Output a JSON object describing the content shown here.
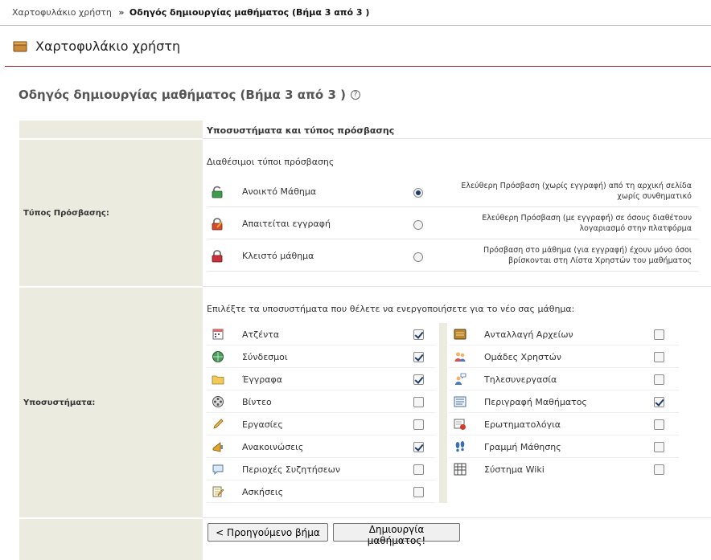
{
  "breadcrumb": {
    "home": "Χαρτοφυλάκιο χρήστη",
    "separator": "»",
    "current": "Οδηγός δημιουργίας μαθήματος (Βήμα 3 από 3 )"
  },
  "page_title": "Χαρτοφυλάκιο χρήστη",
  "wizard_title": "Οδηγός δημιουργίας μαθήματος (Βήμα 3 από 3 )",
  "help_symbol": "?",
  "section_header": "Υποσυστήματα και τύπος πρόσβασης",
  "access": {
    "label": "Τύπος Πρόσβασης:",
    "available_label": "Διαθέσιμοι τύποι πρόσβασης",
    "options": [
      {
        "name": "Ανοικτό Μάθημα",
        "desc1": "Ελεύθερη Πρόσβαση (χωρίς εγγραφή) από τη αρχική σελίδα",
        "desc2": "χωρίς συνθηματικό",
        "selected": true,
        "icon": "lock-open-green-icon"
      },
      {
        "name": "Απαιτείται εγγραφή",
        "desc1": "Ελεύθερη Πρόσβαση (με εγγραφή) σε όσους διαθέτουν",
        "desc2": "λογαριασμό στην πλατφόρμα",
        "selected": false,
        "icon": "lock-registration-icon"
      },
      {
        "name": "Κλειστό μάθημα",
        "desc1": "Πρόσβαση στο μάθημα (για εγγραφή) έχουν μόνο όσοι",
        "desc2": "βρίσκονται στη Λίστα Χρηστών του μαθήματος",
        "selected": false,
        "icon": "lock-closed-red-icon"
      }
    ]
  },
  "modules": {
    "label": "Υποσυστήματα:",
    "prompt": "Επιλέξτε τα υποσυστήματα που θέλετε να ενεργοποιήσετε για το νέο σας μάθημα:",
    "left": [
      {
        "name": "Ατζέντα",
        "checked": true,
        "icon": "calendar-icon"
      },
      {
        "name": "Σύνδεσμοι",
        "checked": true,
        "icon": "globe-link-icon"
      },
      {
        "name": "Έγγραφα",
        "checked": true,
        "icon": "folder-icon"
      },
      {
        "name": "Βίντεο",
        "checked": false,
        "icon": "film-reel-icon"
      },
      {
        "name": "Εργασίες",
        "checked": false,
        "icon": "pencil-icon"
      },
      {
        "name": "Ανακοινώσεις",
        "checked": true,
        "icon": "megaphone-icon"
      },
      {
        "name": "Περιοχές Συζητήσεων",
        "checked": false,
        "icon": "speech-bubble-icon"
      },
      {
        "name": "Ασκήσεις",
        "checked": false,
        "icon": "notepad-pencil-icon"
      }
    ],
    "right": [
      {
        "name": "Ανταλλαγή Αρχείων",
        "checked": false,
        "icon": "file-exchange-icon"
      },
      {
        "name": "Ομάδες Χρηστών",
        "checked": false,
        "icon": "user-group-icon"
      },
      {
        "name": "Τηλεσυνεργασία",
        "checked": false,
        "icon": "conference-user-icon"
      },
      {
        "name": "Περιγραφή Μαθήματος",
        "checked": true,
        "icon": "document-lines-icon"
      },
      {
        "name": "Ερωτηματολόγια",
        "checked": false,
        "icon": "questionnaire-icon"
      },
      {
        "name": "Γραμμή Μάθησης",
        "checked": false,
        "icon": "footprints-icon"
      },
      {
        "name": "Σύστημα Wiki",
        "checked": false,
        "icon": "wiki-grid-icon"
      }
    ]
  },
  "buttons": {
    "previous": "< Προηγούμενο βήμα",
    "create": "Δημιουργία μαθήματος!"
  },
  "colors": {
    "label_bg": "#ecebe0",
    "header_rule": "#9a2020",
    "check": "#1d3a6b"
  }
}
